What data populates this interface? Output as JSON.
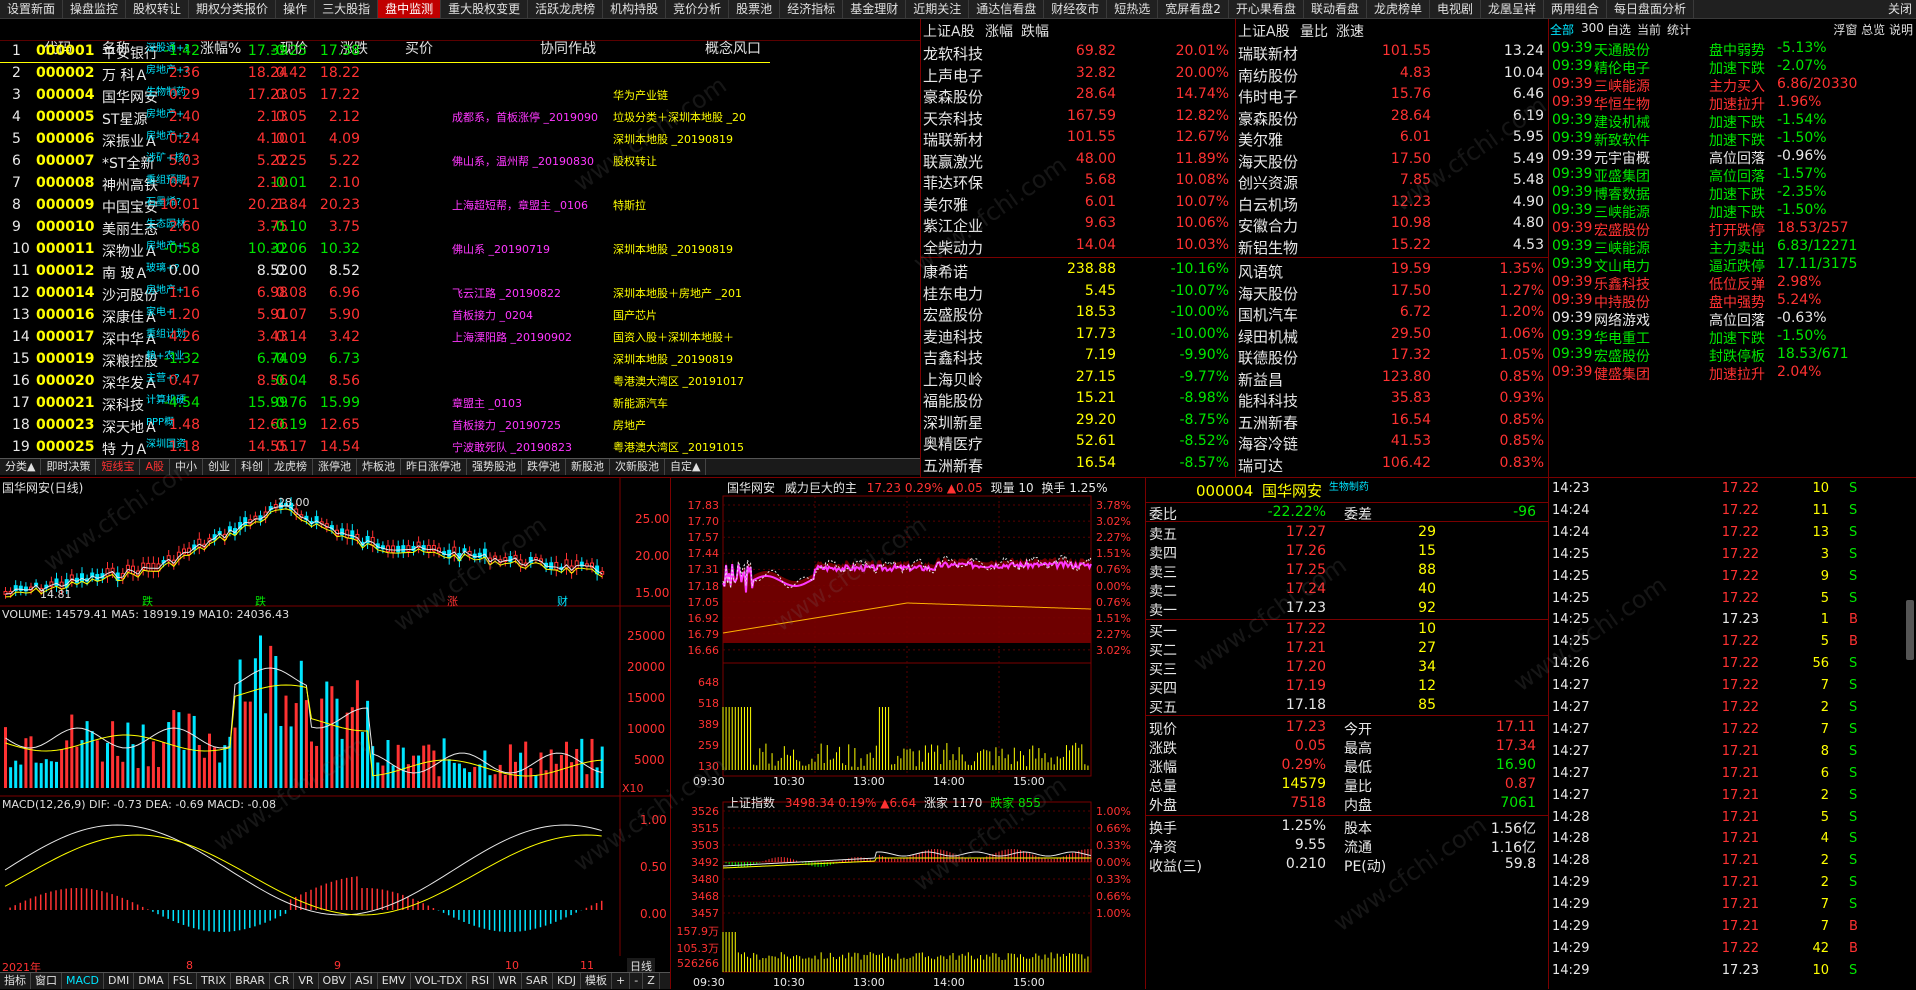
{
  "menu": {
    "items": [
      "设置新面",
      "操盘监控",
      "股权转让",
      "期权分类报价",
      "操作",
      "三大股指",
      "盘中监测",
      "重大股权变更",
      "活跃龙虎榜",
      "机构持股",
      "竞价分析",
      "股票池",
      "经济指标",
      "基金理财",
      "近期关注",
      "通达信看盘",
      "财经夜市",
      "短热选",
      "宽屏看盘2",
      "开心果看盘",
      "联动看盘",
      "龙虎榜单",
      "电视剧",
      "龙凰呈祥",
      "两用组合",
      "每日盘面分析"
    ],
    "active": 6,
    "right": "关闭"
  },
  "grid": {
    "headers": [
      "代码",
      "名称",
      "涨幅%",
      "现价",
      "涨跌",
      "买价",
      "协同作战",
      "概念风口"
    ],
    "rows": [
      {
        "n": "1",
        "code": "000001",
        "name": "平安银行",
        "tag": "深股通+?",
        "chg": "-1.42",
        "price": "17.39",
        "diff": "-0.25",
        "bid": "17.38",
        "xt": "",
        "gn": ""
      },
      {
        "n": "2",
        "code": "000002",
        "name": "万 科Ａ",
        "tag": "房地产+?",
        "chg": "2.36",
        "price": "18.24",
        "diff": "0.42",
        "bid": "18.22",
        "xt": "",
        "gn": ""
      },
      {
        "n": "3",
        "code": "000004",
        "name": "国华网安",
        "tag": "生物制药",
        "chg": "0.29",
        "price": "17.23",
        "diff": "0.05",
        "bid": "17.22",
        "xt": "",
        "gn": "华为产业链"
      },
      {
        "n": "4",
        "code": "000005",
        "name": "ST星源",
        "tag": "房地产+",
        "chg": "2.40",
        "price": "2.13",
        "diff": "0.05",
        "bid": "2.12",
        "xt": "成都系，首板涨停 _2019090",
        "gn": "垃圾分类＋深圳本地股 _20"
      },
      {
        "n": "5",
        "code": "000006",
        "name": "深振业Ａ",
        "tag": "房地产+?",
        "chg": "0.24",
        "price": "4.10",
        "diff": "0.01",
        "bid": "4.09",
        "xt": "",
        "gn": "深圳本地股 _20190819"
      },
      {
        "n": "6",
        "code": "000007",
        "name": "*ST全新",
        "tag": "涉矿+核?",
        "chg": "5.03",
        "price": "5.22",
        "diff": "0.25",
        "bid": "5.22",
        "xt": "佛山系，温州帮 _20190830",
        "gn": "股权转让"
      },
      {
        "n": "7",
        "code": "000008",
        "name": "神州高铁",
        "tag": "重组预期",
        "chg": "0.47",
        "price": "2.10",
        "diff": "-0.01",
        "bid": "2.10",
        "xt": "",
        "gn": ""
      },
      {
        "n": "8",
        "code": "000009",
        "name": "中国宝安",
        "tag": "石墨烯?",
        "chg": "10.01",
        "price": "20.23",
        "diff": "1.84",
        "bid": "20.23",
        "xt": "上海超短帮，章盟主 _0106",
        "gn": "特斯拉"
      },
      {
        "n": "9",
        "code": "000010",
        "name": "美丽生态",
        "tag": "生态园林",
        "chg": "2.60",
        "price": "3.75",
        "diff": "-0.10",
        "bid": "3.75",
        "xt": "",
        "gn": ""
      },
      {
        "n": "10",
        "code": "000011",
        "name": "深物业Ａ",
        "tag": "房地产+",
        "chg": "-0.58",
        "price": "10.32",
        "diff": "-0.06",
        "bid": "10.32",
        "xt": "佛山系 _20190719",
        "gn": "深圳本地股 _20190819"
      },
      {
        "n": "11",
        "code": "000012",
        "name": "南 玻Ａ",
        "tag": "玻璃+?",
        "chg": "0.00",
        "price": "8.52",
        "diff": "0.00",
        "bid": "8.52",
        "xt": "",
        "gn": ""
      },
      {
        "n": "12",
        "code": "000014",
        "name": "沙河股份",
        "tag": "房地产+",
        "chg": "1.16",
        "price": "6.98",
        "diff": "0.08",
        "bid": "6.96",
        "xt": "飞云江路 _20190822",
        "gn": "深圳本地股＋房地产 _201"
      },
      {
        "n": "13",
        "code": "000016",
        "name": "深康佳Ａ",
        "tag": "家电+",
        "chg": "1.20",
        "price": "5.91",
        "diff": "0.07",
        "bid": "5.90",
        "xt": "首板接力 _0204",
        "gn": "国产芯片"
      },
      {
        "n": "14",
        "code": "000017",
        "name": "深中华Ａ",
        "tag": "重组计划",
        "chg": "4.26",
        "price": "3.43",
        "diff": "0.14",
        "bid": "3.42",
        "xt": "上海溧阳路 _20190902",
        "gn": "国资入股＋深圳本地股＋"
      },
      {
        "n": "15",
        "code": "000019",
        "name": "深粮控股",
        "tag": "粮+农业",
        "chg": "-1.32",
        "price": "6.74",
        "diff": "-0.09",
        "bid": "6.73",
        "xt": "",
        "gn": "深圳本地股 _20190819"
      },
      {
        "n": "16",
        "code": "000020",
        "name": "深华发Ａ",
        "tag": "主营+?",
        "chg": "0.47",
        "price": "8.56",
        "diff": "-0.04",
        "bid": "8.56",
        "xt": "",
        "gn": "粤港澳大湾区 _20191017"
      },
      {
        "n": "17",
        "code": "000021",
        "name": "深科技",
        "tag": "计算机硬",
        "chg": "-4.54",
        "price": "15.99",
        "diff": "-0.76",
        "bid": "15.99",
        "xt": "章盟主 _0103",
        "gn": "新能源汽车"
      },
      {
        "n": "18",
        "code": "000023",
        "name": "深天地Ａ",
        "tag": "PPP概",
        "chg": "1.48",
        "price": "12.66",
        "diff": "-0.19",
        "bid": "12.65",
        "xt": "首板接力 _20190725",
        "gn": "房地产"
      },
      {
        "n": "19",
        "code": "000025",
        "name": "特 力Ａ",
        "tag": "深圳国资",
        "chg": "1.18",
        "price": "14.55",
        "diff": "0.17",
        "bid": "14.54",
        "xt": "宁波敢死队 _20190823",
        "gn": "粤港澳大湾区 _20191015"
      }
    ]
  },
  "tabs": {
    "items": [
      "分类▲",
      "即时决策",
      "短线宝",
      "A股",
      "中小",
      "创业",
      "科创",
      "龙虎榜",
      "涨停池",
      "炸板池",
      "昨日涨停池",
      "强势股池",
      "跌停池",
      "新股池",
      "次新股池",
      "自定▲"
    ],
    "selected": 3
  },
  "gainers": {
    "header": [
      "上证A股",
      "涨幅",
      "跌幅"
    ],
    "up": [
      [
        "龙软科技",
        "69.82",
        "20.01%"
      ],
      [
        "上声电子",
        "32.82",
        "20.00%"
      ],
      [
        "豪森股份",
        "28.64",
        "14.74%"
      ],
      [
        "天奈科技",
        "167.59",
        "12.82%"
      ],
      [
        "瑞联新材",
        "101.55",
        "12.67%"
      ],
      [
        "联赢激光",
        "48.00",
        "11.89%"
      ],
      [
        "菲达环保",
        "5.68",
        "10.08%"
      ],
      [
        "美尔雅",
        "6.01",
        "10.07%"
      ],
      [
        "紫江企业",
        "9.63",
        "10.06%"
      ],
      [
        "全柴动力",
        "14.04",
        "10.03%"
      ]
    ],
    "down": [
      [
        "康希诺",
        "238.88",
        "-10.16%"
      ],
      [
        "桂东电力",
        "5.45",
        "-10.07%"
      ],
      [
        "宏盛股份",
        "18.53",
        "-10.00%"
      ],
      [
        "麦迪科技",
        "17.73",
        "-10.00%"
      ],
      [
        "吉鑫科技",
        "7.19",
        "-9.90%"
      ],
      [
        "上海贝岭",
        "27.15",
        "-9.77%"
      ],
      [
        "福能股份",
        "15.21",
        "-8.98%"
      ],
      [
        "深圳新星",
        "29.20",
        "-8.75%"
      ],
      [
        "奥精医疗",
        "52.61",
        "-8.52%"
      ],
      [
        "五洲新春",
        "16.54",
        "-8.57%"
      ]
    ]
  },
  "volratio": {
    "header": [
      "上证A股",
      "量比",
      "涨速"
    ],
    "up": [
      [
        "瑞联新材",
        "101.55",
        "13.24"
      ],
      [
        "南纺股份",
        "4.83",
        "10.04"
      ],
      [
        "伟时电子",
        "15.76",
        "6.46"
      ],
      [
        "豪森股份",
        "28.64",
        "6.19"
      ],
      [
        "美尔雅",
        "6.01",
        "5.95"
      ],
      [
        "海天股份",
        "17.50",
        "5.49"
      ],
      [
        "创兴资源",
        "7.85",
        "5.48"
      ],
      [
        "白云机场",
        "12.23",
        "4.90"
      ],
      [
        "安徽合力",
        "10.98",
        "4.80"
      ],
      [
        "新铝生物",
        "15.22",
        "4.53"
      ]
    ],
    "down": [
      [
        "风语筑",
        "19.59",
        "1.35%"
      ],
      [
        "海天股份",
        "17.50",
        "1.27%"
      ],
      [
        "国机汽车",
        "6.72",
        "1.20%"
      ],
      [
        "绿田机械",
        "29.50",
        "1.06%"
      ],
      [
        "联德股份",
        "17.32",
        "1.05%"
      ],
      [
        "新益昌",
        "123.80",
        "0.85%"
      ],
      [
        "能科科技",
        "35.83",
        "0.93%"
      ],
      [
        "五洲新春",
        "16.54",
        "0.85%"
      ],
      [
        "海容冷链",
        "41.53",
        "0.85%"
      ],
      [
        "瑞可达",
        "106.42",
        "0.83%"
      ]
    ]
  },
  "alerts": {
    "header": [
      "全部",
      "300",
      "自选",
      "当前",
      "统计"
    ],
    "header_right": "浮窗 总览 说明",
    "rows": [
      [
        "09:39",
        "天通股份",
        "盘中弱势",
        "-5.13%",
        "g"
      ],
      [
        "09:39",
        "精伦电子",
        "加速下跌",
        "-2.07%",
        "g"
      ],
      [
        "09:39",
        "三峡能源",
        "主力买入",
        "6.86/20330",
        "r"
      ],
      [
        "09:39",
        "华恒生物",
        "加速拉升",
        "1.96%",
        "r"
      ],
      [
        "09:39",
        "建设机械",
        "加速下跌",
        "-1.54%",
        "g"
      ],
      [
        "09:39",
        "新致软件",
        "加速下跌",
        "-1.50%",
        "g"
      ],
      [
        "09:39",
        "元宇宙概",
        "高位回落",
        "-0.96%",
        "w"
      ],
      [
        "09:39",
        "亚盛集团",
        "高位回落",
        "-1.57%",
        "g"
      ],
      [
        "09:39",
        "博睿数据",
        "加速下跌",
        "-2.35%",
        "g"
      ],
      [
        "09:39",
        "三峡能源",
        "加速下跌",
        "-1.50%",
        "g"
      ],
      [
        "09:39",
        "宏盛股份",
        "打开跌停",
        "18.53/257",
        "r"
      ],
      [
        "09:39",
        "三峡能源",
        "主力卖出",
        "6.83/12271",
        "g"
      ],
      [
        "09:39",
        "文山电力",
        "逼近跌停",
        "17.11/3175",
        "g"
      ],
      [
        "09:39",
        "乐鑫科技",
        "低位反弹",
        "2.98%",
        "r"
      ],
      [
        "09:39",
        "中持股份",
        "盘中强势",
        "5.24%",
        "r"
      ],
      [
        "09:39",
        "网络游戏",
        "高位回落",
        "-0.63%",
        "w"
      ],
      [
        "09:39",
        "华电重工",
        "加速下跌",
        "-1.50%",
        "g"
      ],
      [
        "09:39",
        "宏盛股份",
        "封跌停板",
        "18.53/671",
        "g"
      ],
      [
        "09:39",
        "健盛集团",
        "加速拉升",
        "2.04%",
        "r"
      ]
    ]
  },
  "kline": {
    "title": "国华网安(日线)",
    "high": "28.00",
    "low": "14.81",
    "yticks": [
      "25.00",
      "20.00",
      "15.00"
    ],
    "labels": [
      "跌",
      "跌",
      "涨",
      "财"
    ],
    "vol_title": "VOLUME: 14579.41  MA5: 18919.19  MA10: 24036.43",
    "vol_yticks": [
      "25000",
      "20000",
      "15000",
      "10000",
      "5000"
    ],
    "vol_unit": "X10",
    "macd_title": "MACD(12,26,9)  DIF: -0.73  DEA: -0.69  MACD: -0.08",
    "macd_yticks": [
      "1.00",
      "0.50",
      "0.00"
    ],
    "xlabels": [
      "2021年",
      "8",
      "9",
      "10",
      "11"
    ],
    "sel_label": "日线"
  },
  "intraday": {
    "title": "国华网安",
    "subtitle": "威力巨大的主",
    "price": "17.23",
    "pct": "0.29%",
    "delta": "▲0.05",
    "cur": "现量 10",
    "turn": "换手 1.25%",
    "yl": [
      "17.83",
      "17.70",
      "17.57",
      "17.44",
      "17.31",
      "17.18",
      "17.05",
      "16.92",
      "16.79",
      "16.66"
    ],
    "yr": [
      "3.78%",
      "3.02%",
      "2.27%",
      "1.51%",
      "0.76%",
      "0.00%",
      "0.76%",
      "1.51%",
      "2.27%",
      "3.02%"
    ],
    "vol": [
      "648",
      "518",
      "389",
      "259",
      "130"
    ],
    "time": [
      "09:30",
      "10:30",
      "13:00",
      "14:00",
      "15:00"
    ]
  },
  "index": {
    "title": "上证指数",
    "val": "3498.34",
    "pct": "0.19%",
    "delta": "▲6.64",
    "up": "涨家 1170",
    "down": "跌家 855",
    "yl": [
      "3526",
      "3515",
      "3503",
      "3492",
      "3480",
      "3468",
      "3457"
    ],
    "yr": [
      "1.00%",
      "0.66%",
      "0.33%",
      "0.00%",
      "0.33%",
      "0.66%",
      "1.00%"
    ],
    "vol": [
      "157.9万",
      "105.3万",
      "526266"
    ]
  },
  "quote": {
    "code": "000004",
    "name": "国华网安",
    "tag": "生物制药",
    "wb_label": "委比",
    "wb": "-22.22%",
    "wc_label": "委差",
    "wc": "-96",
    "asks": [
      [
        "卖五",
        "17.27",
        "29"
      ],
      [
        "卖四",
        "17.26",
        "15"
      ],
      [
        "卖三",
        "17.25",
        "88"
      ],
      [
        "卖二",
        "17.24",
        "40"
      ],
      [
        "卖一",
        "17.23",
        "92"
      ]
    ],
    "bids": [
      [
        "买一",
        "17.22",
        "10"
      ],
      [
        "买二",
        "17.21",
        "27"
      ],
      [
        "买三",
        "17.20",
        "34"
      ],
      [
        "买四",
        "17.19",
        "12"
      ],
      [
        "买五",
        "17.18",
        "85"
      ]
    ],
    "stats": [
      [
        "现价",
        "17.23",
        "今开",
        "17.11"
      ],
      [
        "涨跌",
        "0.05",
        "最高",
        "17.34"
      ],
      [
        "涨幅",
        "0.29%",
        "最低",
        "16.90"
      ],
      [
        "总量",
        "14579",
        "量比",
        "0.87"
      ],
      [
        "外盘",
        "7518",
        "内盘",
        "7061"
      ]
    ],
    "stats2": [
      [
        "换手",
        "1.25%",
        "股本",
        "1.56亿"
      ],
      [
        "净资",
        "9.55",
        "流通",
        "1.16亿"
      ],
      [
        "收益(三)",
        "0.210",
        "PE(动)",
        "59.8"
      ]
    ]
  },
  "ticks": [
    [
      "14:23",
      "17.22",
      "10",
      "S"
    ],
    [
      "14:24",
      "17.22",
      "11",
      "S"
    ],
    [
      "14:24",
      "17.22",
      "13",
      "S"
    ],
    [
      "14:25",
      "17.22",
      "3",
      "S"
    ],
    [
      "14:25",
      "17.22",
      "9",
      "S"
    ],
    [
      "14:25",
      "17.22",
      "5",
      "S"
    ],
    [
      "14:25",
      "17.23",
      "1",
      "B"
    ],
    [
      "14:25",
      "17.22",
      "5",
      "B"
    ],
    [
      "14:26",
      "17.22",
      "56",
      "S"
    ],
    [
      "14:27",
      "17.22",
      "7",
      "S"
    ],
    [
      "14:27",
      "17.22",
      "2",
      "S"
    ],
    [
      "14:27",
      "17.22",
      "7",
      "S"
    ],
    [
      "14:27",
      "17.21",
      "8",
      "S"
    ],
    [
      "14:27",
      "17.21",
      "6",
      "S"
    ],
    [
      "14:27",
      "17.21",
      "2",
      "S"
    ],
    [
      "14:28",
      "17.21",
      "5",
      "S"
    ],
    [
      "14:28",
      "17.21",
      "4",
      "S"
    ],
    [
      "14:28",
      "17.21",
      "2",
      "S"
    ],
    [
      "14:29",
      "17.21",
      "2",
      "S"
    ],
    [
      "14:29",
      "17.21",
      "7",
      "S"
    ],
    [
      "14:29",
      "17.21",
      "7",
      "B"
    ],
    [
      "14:29",
      "17.22",
      "42",
      "B"
    ],
    [
      "14:29",
      "17.23",
      "10",
      "S"
    ]
  ],
  "idxbar": {
    "items": [
      "指标",
      "窗口",
      "MACD",
      "DMI",
      "DMA",
      "FSL",
      "TRIX",
      "BRAR",
      "CR",
      "VR",
      "OBV",
      "ASI",
      "EMV",
      "VOL-TDX",
      "RSI",
      "WR",
      "SAR",
      "KDJ"
    ],
    "selected": 2,
    "right": [
      "模板",
      "+",
      "-",
      "Z"
    ]
  },
  "watermark": "www.cfchi.com"
}
